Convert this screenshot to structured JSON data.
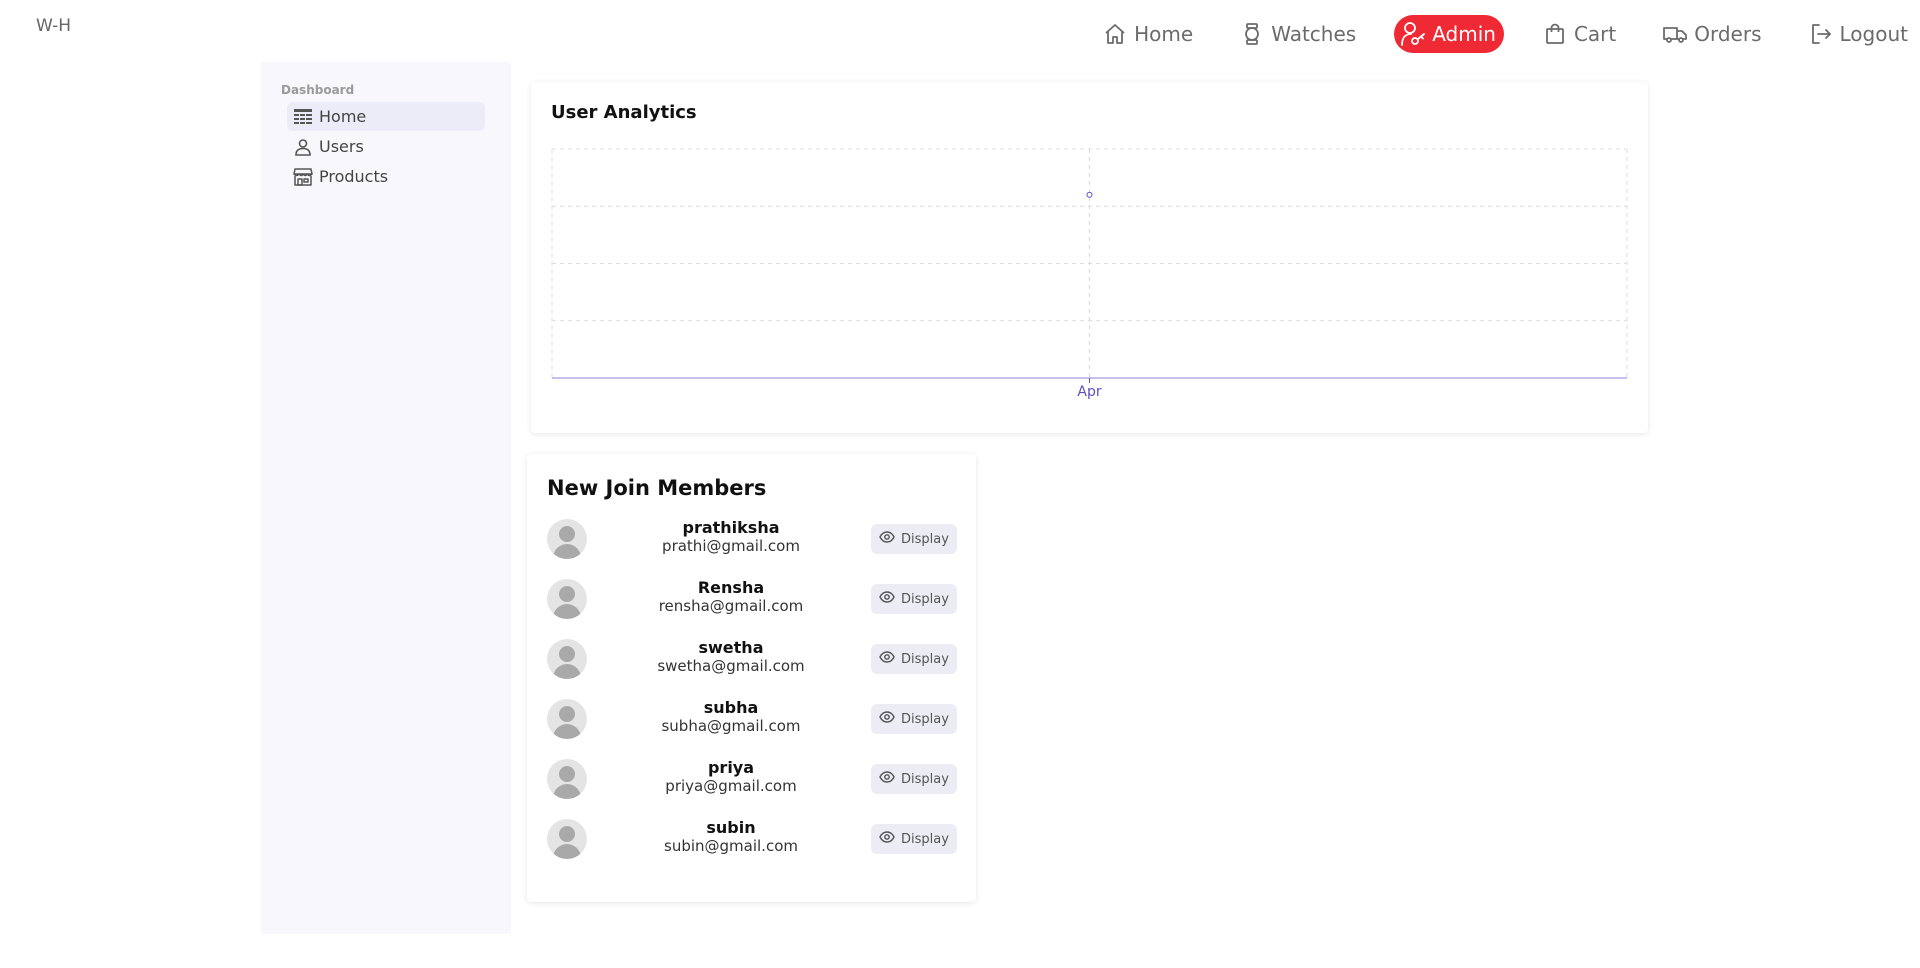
{
  "brand": "W-H",
  "nav": {
    "home": "Home",
    "watches": "Watches",
    "admin": "Admin",
    "cart": "Cart",
    "orders": "Orders",
    "logout": "Logout"
  },
  "sidebar": {
    "title": "Dashboard",
    "items": [
      {
        "label": "Home",
        "icon": "table-icon"
      },
      {
        "label": "Users",
        "icon": "user-icon"
      },
      {
        "label": "Products",
        "icon": "store-icon"
      }
    ]
  },
  "analytics": {
    "title": "User Analytics"
  },
  "chart_data": {
    "type": "line",
    "categories": [
      "Apr"
    ],
    "series": [
      {
        "values": [
          4
        ]
      }
    ],
    "ylim": [
      0,
      5
    ],
    "grid": true,
    "color": "#5b4fc7"
  },
  "members": {
    "title": "New Join Members",
    "display_label": "Display",
    "list": [
      {
        "name": "prathiksha",
        "email": "prathi@gmail.com"
      },
      {
        "name": "Rensha",
        "email": "rensha@gmail.com"
      },
      {
        "name": "swetha",
        "email": "swetha@gmail.com"
      },
      {
        "name": "subha",
        "email": "subha@gmail.com"
      },
      {
        "name": "priya",
        "email": "priya@gmail.com"
      },
      {
        "name": "subin",
        "email": "subin@gmail.com"
      }
    ]
  },
  "colors": {
    "accent": "#ef2a35",
    "chart_line": "#5b4fc7",
    "sidebar_bg": "#f8f8fc"
  }
}
